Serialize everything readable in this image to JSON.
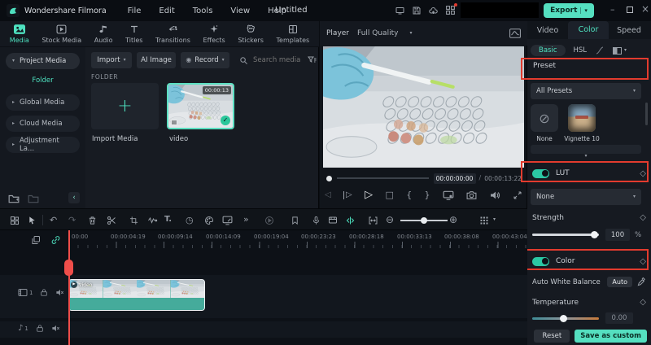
{
  "icons": {
    "caret_down": "▾",
    "caret_right": "▸",
    "collapse_left": "‹",
    "more_h": "•••",
    "more_chevrons": "»",
    "undo": "↶",
    "redo": "↷",
    "clock": "◷",
    "play": "▷",
    "stop": "□",
    "prev_frame": "◁",
    "next_frame": "▷",
    "brace_open": "{",
    "brace_close": "}",
    "record_dot": "◉",
    "plus": "+",
    "check": "✓",
    "diamond": "◇",
    "music_note": "♪",
    "minus_circle": "⊖",
    "plus_circle": "⊕",
    "window_min": "–",
    "window_close": "×",
    "text_tool": "T.",
    "slash": "/",
    "circle_slash": "⊘",
    "scrub_dot": "●"
  },
  "topbar": {
    "app_name": "Wondershare Filmora",
    "menus": [
      "File",
      "Edit",
      "Tools",
      "View",
      "Help"
    ],
    "project_title": "Untitled",
    "export_label": "Export"
  },
  "media": {
    "tabs": [
      {
        "label": "Media"
      },
      {
        "label": "Stock Media"
      },
      {
        "label": "Audio"
      },
      {
        "label": "Titles"
      },
      {
        "label": "Transitions"
      },
      {
        "label": "Effects"
      },
      {
        "label": "Stickers"
      },
      {
        "label": "Templates"
      }
    ],
    "sidebar": {
      "project_media": "Project Media",
      "folder": "Folder",
      "items": [
        "Global Media",
        "Cloud Media",
        "Adjustment La..."
      ]
    },
    "toolbar": {
      "import": "Import",
      "ai_image": "AI Image",
      "record": "Record",
      "search_placeholder": "Search media"
    },
    "folder_section": "FOLDER",
    "import_tile_label": "Import Media",
    "video_label": "video",
    "video_duration": "00:00:13"
  },
  "player": {
    "label": "Player",
    "quality": "Full Quality",
    "time_current": "00:00:00:00",
    "time_total": "00:00:13:22"
  },
  "color": {
    "tabs": [
      "Video",
      "Color",
      "Speed"
    ],
    "basic": "Basic",
    "hsl": "HSL",
    "preset": "Preset",
    "all_presets": "All Presets",
    "preset_none": "None",
    "preset_vignette": "Vignette 10",
    "lut": "LUT",
    "lut_value": "None",
    "strength": "Strength",
    "strength_value": "100",
    "percent": "%",
    "color_section": "Color",
    "awb": "Auto White Balance",
    "auto": "Auto",
    "temperature": "Temperature",
    "temp_value": "0.00",
    "reset": "Reset",
    "save": "Save as custom"
  },
  "timeline": {
    "ruler": [
      "00:00",
      "00:00:04:19",
      "00:00:09:14",
      "00:00:14:09",
      "00:00:19:04",
      "00:00:23:23",
      "00:00:28:18",
      "00:00:33:13",
      "00:00:38:08",
      "00:00:43:04"
    ],
    "video_track_num": "1",
    "audio_track_num": "1",
    "clip_label": "video"
  },
  "colors": {
    "accent": "#4ee0bf",
    "export_bg": "#55dfc0",
    "annotation_red": "#e23b2e",
    "clip_teal": "#45ab9b",
    "playhead_red": "#ef4e4a"
  }
}
